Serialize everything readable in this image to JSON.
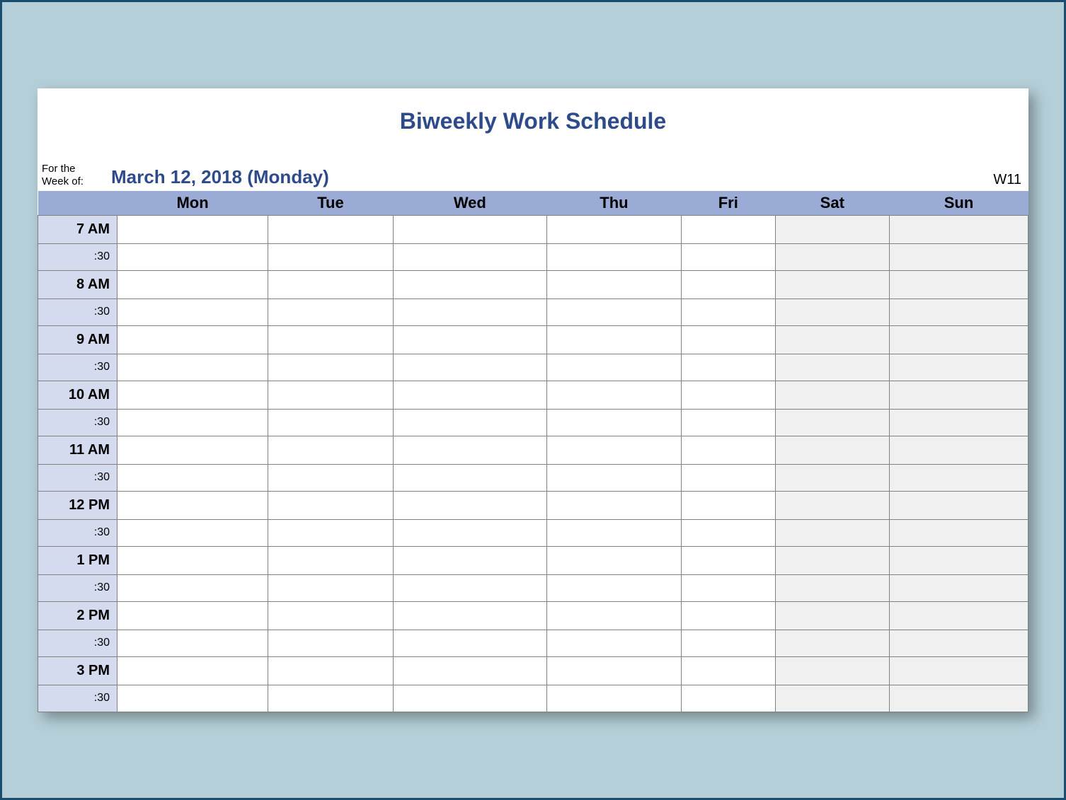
{
  "title": "Biweekly Work Schedule",
  "meta": {
    "label_line1": "For the",
    "label_line2": "Week of:",
    "date": "March 12, 2018 (Monday)",
    "week_number": "W11"
  },
  "days": [
    "Mon",
    "Tue",
    "Wed",
    "Thu",
    "Fri",
    "Sat",
    "Sun"
  ],
  "half_label": ":30",
  "hours": [
    "7 AM",
    "8 AM",
    "9 AM",
    "10 AM",
    "11 AM",
    "12 PM",
    "1 PM",
    "2 PM",
    "3 PM"
  ]
}
